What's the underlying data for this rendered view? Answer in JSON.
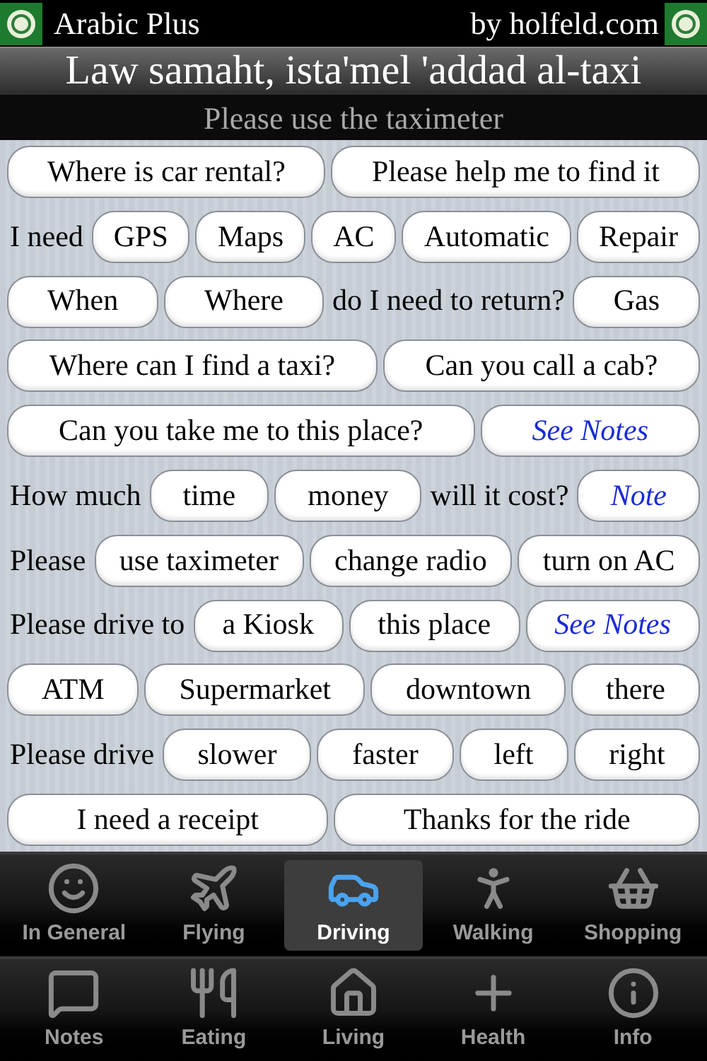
{
  "header": {
    "app_name": "Arabic Plus",
    "credit": "by holfeld.com"
  },
  "phrase": {
    "transliteration": "Law samaht, ista'mel 'addad al-taxi",
    "translation": "Please use the taximeter"
  },
  "rows": [
    [
      {
        "kind": "phrase",
        "text": "Where is car rental?"
      },
      {
        "kind": "phrase",
        "text": "Please help me to find it"
      }
    ],
    [
      {
        "kind": "text",
        "text": "I need"
      },
      {
        "kind": "phrase",
        "text": "GPS"
      },
      {
        "kind": "phrase",
        "text": "Maps"
      },
      {
        "kind": "phrase",
        "text": "AC"
      },
      {
        "kind": "phrase",
        "text": "Automatic"
      },
      {
        "kind": "phrase",
        "text": "Repair"
      }
    ],
    [
      {
        "kind": "phrase",
        "text": "When"
      },
      {
        "kind": "phrase",
        "text": "Where"
      },
      {
        "kind": "text",
        "text": "do I need to return?"
      },
      {
        "kind": "phrase",
        "text": "Gas"
      }
    ],
    [
      {
        "kind": "phrase",
        "text": "Where can I find a taxi?"
      },
      {
        "kind": "phrase",
        "text": "Can you call a cab?"
      }
    ],
    [
      {
        "kind": "phrase",
        "text": "Can you take me to this place?"
      },
      {
        "kind": "note",
        "text": "See Notes"
      }
    ],
    [
      {
        "kind": "text",
        "text": "How much"
      },
      {
        "kind": "phrase",
        "text": "time"
      },
      {
        "kind": "phrase",
        "text": "money"
      },
      {
        "kind": "text",
        "text": "will it cost?"
      },
      {
        "kind": "note",
        "text": "Note"
      }
    ],
    [
      {
        "kind": "text",
        "text": "Please"
      },
      {
        "kind": "phrase",
        "text": "use taximeter"
      },
      {
        "kind": "phrase",
        "text": "change radio"
      },
      {
        "kind": "phrase",
        "text": "turn on AC"
      }
    ],
    [
      {
        "kind": "text",
        "text": "Please drive to"
      },
      {
        "kind": "phrase",
        "text": "a Kiosk"
      },
      {
        "kind": "phrase",
        "text": "this place"
      },
      {
        "kind": "note",
        "text": "See Notes"
      }
    ],
    [
      {
        "kind": "phrase",
        "text": "ATM"
      },
      {
        "kind": "phrase",
        "text": "Supermarket"
      },
      {
        "kind": "phrase",
        "text": "downtown"
      },
      {
        "kind": "phrase",
        "text": "there"
      }
    ],
    [
      {
        "kind": "text",
        "text": "Please drive"
      },
      {
        "kind": "phrase",
        "text": "slower"
      },
      {
        "kind": "phrase",
        "text": "faster"
      },
      {
        "kind": "phrase",
        "text": "left"
      },
      {
        "kind": "phrase",
        "text": "right"
      }
    ],
    [
      {
        "kind": "phrase",
        "text": "I need a receipt"
      },
      {
        "kind": "phrase",
        "text": "Thanks for the ride"
      }
    ]
  ],
  "tab_bars": [
    [
      {
        "label": "In General",
        "kind": "smile",
        "selected": false
      },
      {
        "label": "Flying",
        "kind": "plane",
        "selected": false
      },
      {
        "label": "Driving",
        "kind": "car",
        "selected": true
      },
      {
        "label": "Walking",
        "kind": "walk",
        "selected": false
      },
      {
        "label": "Shopping",
        "kind": "basket",
        "selected": false
      }
    ],
    [
      {
        "label": "Notes",
        "kind": "notes",
        "selected": false
      },
      {
        "label": "Eating",
        "kind": "fork",
        "selected": false
      },
      {
        "label": "Living",
        "kind": "house",
        "selected": false
      },
      {
        "label": "Health",
        "kind": "plus",
        "selected": false
      },
      {
        "label": "Info",
        "kind": "info",
        "selected": false
      }
    ]
  ]
}
